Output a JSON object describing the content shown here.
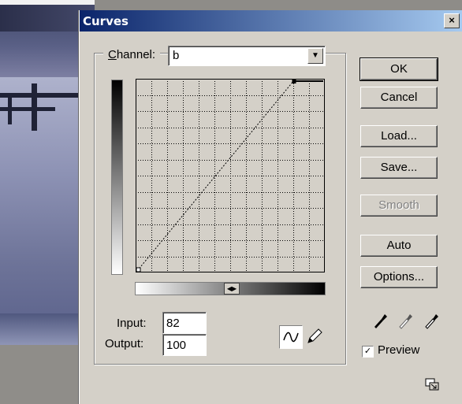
{
  "window": {
    "title": "Curves",
    "close_glyph": "×"
  },
  "channel": {
    "label": "Channel:",
    "value": "b"
  },
  "input": {
    "label": "Input:",
    "value": "82"
  },
  "output": {
    "label": "Output:",
    "value": "100"
  },
  "buttons": {
    "ok": "OK",
    "cancel": "Cancel",
    "load": "Load...",
    "save": "Save...",
    "smooth": "Smooth",
    "auto": "Auto",
    "options": "Options..."
  },
  "preview": {
    "label": "Preview",
    "checked": true
  },
  "curve": {
    "points": [
      [
        0,
        0
      ],
      [
        215,
        255
      ],
      [
        255,
        255
      ]
    ],
    "range": [
      0,
      255
    ]
  },
  "icons": [
    "curve-tool-icon",
    "pencil-icon",
    "black-eyedropper-icon",
    "gray-eyedropper-icon",
    "white-eyedropper-icon",
    "expand-icon"
  ]
}
